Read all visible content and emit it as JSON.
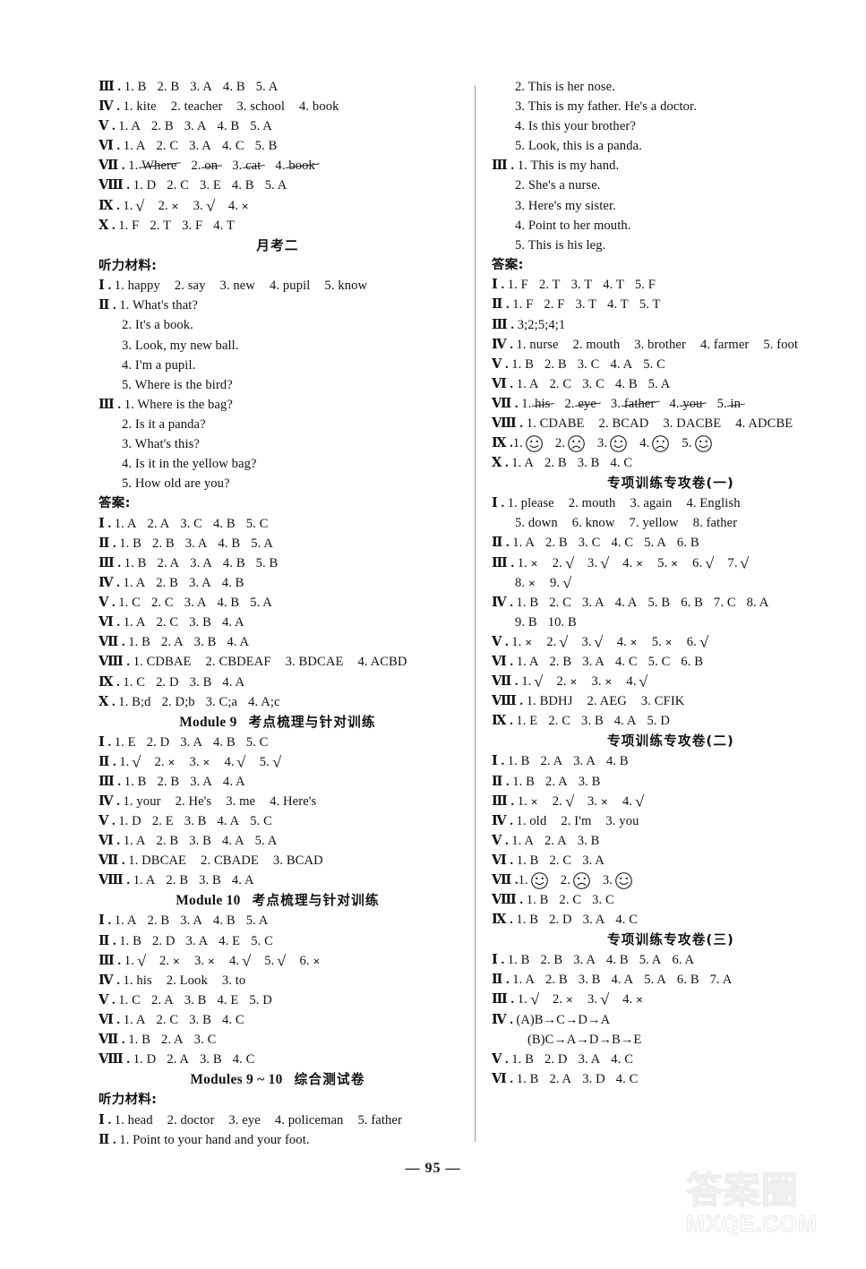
{
  "page": {
    "number": "— 95 —",
    "watermark_cn": "答案圈",
    "watermark_en": "MXQE.COM"
  },
  "labels": {
    "answers": "答案:",
    "listening": "听力材料:"
  },
  "left_column": {
    "top_block": [
      {
        "rn": "Ⅲ",
        "items": [
          "1. B",
          "2. B",
          "3. A",
          "4. B",
          "5. A"
        ]
      },
      {
        "rn": "Ⅳ",
        "items": [
          "1. kite",
          "2. teacher",
          "3. school",
          "4. book"
        ],
        "wide": true
      },
      {
        "rn": "Ⅴ",
        "items": [
          "1. A",
          "2. B",
          "3. A",
          "4. B",
          "5. A"
        ]
      },
      {
        "rn": "Ⅵ",
        "items": [
          "1. A",
          "2. C",
          "3. A",
          "4. C",
          "5. B"
        ]
      },
      {
        "rn": "Ⅶ",
        "fill_items": [
          "1.  Where",
          "2. on",
          "3. cat",
          "4. book"
        ]
      },
      {
        "rn": "Ⅷ",
        "items": [
          "1. D",
          "2. C",
          "3. E",
          "4. B",
          "5. A"
        ]
      },
      {
        "rn": "Ⅸ",
        "marks": [
          [
            "1.",
            "tick"
          ],
          [
            "2.",
            "cross"
          ],
          [
            "3.",
            "tick"
          ],
          [
            "4.",
            "cross"
          ]
        ]
      },
      {
        "rn": "Ⅹ",
        "items": [
          "1. F",
          "2. T",
          "3. F",
          "4. T"
        ]
      }
    ],
    "heading_yuekao2": "月考二",
    "yuekao2_listening": [
      {
        "rn": "Ⅰ",
        "items": [
          "1. happy",
          "2. say",
          "3. new",
          "4. pupil",
          "5. know"
        ],
        "wide": true
      },
      {
        "rn": "Ⅱ",
        "items": [
          "1. What's that?"
        ]
      },
      {
        "indent": true,
        "items": [
          "2. It's a book."
        ]
      },
      {
        "indent": true,
        "items": [
          "3. Look, my new ball."
        ]
      },
      {
        "indent": true,
        "items": [
          "4. I'm a pupil."
        ]
      },
      {
        "indent": true,
        "items": [
          "5. Where is the bird?"
        ]
      },
      {
        "rn": "Ⅲ",
        "items": [
          "1. Where is the bag?"
        ]
      },
      {
        "indent": true,
        "items": [
          "2. Is it a panda?"
        ]
      },
      {
        "indent": true,
        "items": [
          "3. What's this?"
        ]
      },
      {
        "indent": true,
        "items": [
          "4. Is it in the yellow bag?"
        ]
      },
      {
        "indent": true,
        "items": [
          "5. How old are you?"
        ]
      }
    ],
    "yuekao2_answers": [
      {
        "rn": "Ⅰ",
        "items": [
          "1. A",
          "2. A",
          "3. C",
          "4. B",
          "5. C"
        ]
      },
      {
        "rn": "Ⅱ",
        "items": [
          "1. B",
          "2. B",
          "3. A",
          "4. B",
          "5. A"
        ]
      },
      {
        "rn": "Ⅲ",
        "items": [
          "1. B",
          "2. A",
          "3. A",
          "4. B",
          "5. B"
        ]
      },
      {
        "rn": "Ⅳ",
        "items": [
          "1. A",
          "2. B",
          "3. A",
          "4. B"
        ]
      },
      {
        "rn": "Ⅴ",
        "items": [
          "1. C",
          "2. C",
          "3. A",
          "4. B",
          "5. A"
        ]
      },
      {
        "rn": "Ⅵ",
        "items": [
          "1. A",
          "2. C",
          "3. B",
          "4. A"
        ]
      },
      {
        "rn": "Ⅶ",
        "items": [
          "1. B",
          "2. A",
          "3. B",
          "4. A"
        ]
      },
      {
        "rn": "Ⅷ",
        "items": [
          "1. CDBAE",
          "2. CBDEAF",
          "3. BDCAE",
          "4. ACBD"
        ],
        "wide": true
      },
      {
        "rn": "Ⅸ",
        "items": [
          "1. C",
          "2. D",
          "3. B",
          "4. A"
        ]
      },
      {
        "rn": "Ⅹ",
        "items": [
          "1. B;d",
          "2. D;b",
          "3. C;a",
          "4. A;c"
        ]
      }
    ],
    "heading_module9": {
      "en": "Module 9",
      "cn": "考点梳理与针对训练"
    },
    "module9": [
      {
        "rn": "Ⅰ",
        "items": [
          "1. E",
          "2. D",
          "3. A",
          "4. B",
          "5. C"
        ]
      },
      {
        "rn": "Ⅱ",
        "marks": [
          [
            "1.",
            "tick"
          ],
          [
            "2.",
            "cross"
          ],
          [
            "3.",
            "cross"
          ],
          [
            "4.",
            "tick"
          ],
          [
            "5.",
            "tick"
          ]
        ]
      },
      {
        "rn": "Ⅲ",
        "items": [
          "1. B",
          "2. B",
          "3. A",
          "4. A"
        ]
      },
      {
        "rn": "Ⅳ",
        "items": [
          "1. your",
          "2. He's",
          "3. me",
          "4. Here's"
        ],
        "wide": true
      },
      {
        "rn": "Ⅴ",
        "items": [
          "1. D",
          "2. E",
          "3. B",
          "4. A",
          "5. C"
        ]
      },
      {
        "rn": "Ⅵ",
        "items": [
          "1. A",
          "2. B",
          "3. B",
          "4. A",
          "5. A"
        ]
      },
      {
        "rn": "Ⅶ",
        "items": [
          "1. DBCAE",
          "2. CBADE",
          "3. BCAD"
        ],
        "wide": true
      },
      {
        "rn": "Ⅷ",
        "items": [
          "1. A",
          "2. B",
          "3. B",
          "4. A"
        ]
      }
    ],
    "heading_module10": {
      "en": "Module 10",
      "cn": "考点梳理与针对训练"
    },
    "module10": [
      {
        "rn": "Ⅰ",
        "items": [
          "1. A",
          "2. B",
          "3. A",
          "4. B",
          "5. A"
        ]
      },
      {
        "rn": "Ⅱ",
        "items": [
          "1. B",
          "2. D",
          "3. A",
          "4. E",
          "5. C"
        ]
      },
      {
        "rn": "Ⅲ",
        "marks": [
          [
            "1.",
            "tick"
          ],
          [
            "2.",
            "cross"
          ],
          [
            "3.",
            "cross"
          ],
          [
            "4.",
            "tick"
          ],
          [
            "5.",
            "tick"
          ],
          [
            "6.",
            "cross"
          ]
        ]
      },
      {
        "rn": "Ⅳ",
        "items": [
          "1. his",
          "2. Look",
          "3. to"
        ],
        "wide": true
      },
      {
        "rn": "Ⅴ",
        "items": [
          "1. C",
          "2. A",
          "3. B",
          "4. E",
          "5. D"
        ]
      },
      {
        "rn": "Ⅵ",
        "items": [
          "1. A",
          "2. C",
          "3. B",
          "4. C"
        ]
      },
      {
        "rn": "Ⅶ",
        "items": [
          "1. B",
          "2. A",
          "3. C"
        ]
      },
      {
        "rn": "Ⅷ",
        "items": [
          "1. D",
          "2. A",
          "3. B",
          "4. C"
        ]
      }
    ],
    "heading_modules910": {
      "en": "Modules 9 ~ 10",
      "cn": "综合测试卷"
    },
    "modules910_listening": [
      {
        "rn": "Ⅰ",
        "items": [
          "1. head",
          "2. doctor",
          "3. eye",
          "4. policeman",
          "5. father"
        ],
        "wide": true
      },
      {
        "rn": "Ⅱ",
        "items": [
          "1. Point to your hand and your foot."
        ]
      }
    ]
  },
  "right_column": {
    "listening_cont": [
      {
        "indent": true,
        "items": [
          "2. This is her nose."
        ]
      },
      {
        "indent": true,
        "items": [
          "3. This is my father.  He's a doctor."
        ]
      },
      {
        "indent": true,
        "items": [
          "4. Is this your brother?"
        ]
      },
      {
        "indent": true,
        "items": [
          "5. Look, this is a panda."
        ]
      },
      {
        "rn": "Ⅲ",
        "items": [
          "1. This is my hand."
        ]
      },
      {
        "indent": true,
        "items": [
          "2. She's a nurse."
        ]
      },
      {
        "indent": true,
        "items": [
          "3. Here's my sister."
        ]
      },
      {
        "indent": true,
        "items": [
          "4. Point to her mouth."
        ]
      },
      {
        "indent": true,
        "items": [
          "5. This is his leg."
        ]
      }
    ],
    "modules910_answers": [
      {
        "rn": "Ⅰ",
        "items": [
          "1. F",
          "2. T",
          "3. T",
          "4. T",
          "5. F"
        ]
      },
      {
        "rn": "Ⅱ",
        "items": [
          "1. F",
          "2. F",
          "3. T",
          "4. T",
          "5. T"
        ]
      },
      {
        "rn": "Ⅲ",
        "items": [
          "3;2;5;4;1"
        ]
      },
      {
        "rn": "Ⅳ",
        "items": [
          "1. nurse",
          "2. mouth",
          "3. brother",
          "4. farmer",
          "5. foot"
        ],
        "wide": true
      },
      {
        "rn": "Ⅴ",
        "items": [
          "1. B",
          "2. B",
          "3. C",
          "4. A",
          "5. C"
        ]
      },
      {
        "rn": "Ⅵ",
        "items": [
          "1. A",
          "2. C",
          "3. C",
          "4. B",
          "5. A"
        ]
      },
      {
        "rn": "Ⅶ",
        "fill_items": [
          "1.  his",
          "2. eye",
          "3. father",
          "4. you",
          "5. in"
        ]
      },
      {
        "rn": "Ⅷ",
        "items": [
          "1. CDABE",
          "2. BCAD",
          "3. DACBE",
          "4. ADCBE"
        ],
        "wide": true
      },
      {
        "rn": "Ⅸ",
        "faces": [
          [
            "1.",
            "smile"
          ],
          [
            "2.",
            "frown"
          ],
          [
            "3.",
            "smile"
          ],
          [
            "4.",
            "frown"
          ],
          [
            "5.",
            "smile"
          ]
        ]
      },
      {
        "rn": "Ⅹ",
        "items": [
          "1. A",
          "2. B",
          "3. B",
          "4. C"
        ]
      }
    ],
    "heading_zhuanxiang1": "专项训练专攻卷(一)",
    "zhuanxiang1": [
      {
        "rn": "Ⅰ",
        "items": [
          "1. please",
          "2. mouth",
          "3. again",
          "4. English"
        ],
        "wide": true
      },
      {
        "indent": true,
        "items": [
          "5. down",
          "6. know",
          "7. yellow",
          "8. father"
        ],
        "wide": true
      },
      {
        "rn": "Ⅱ",
        "items": [
          "1. A",
          "2. B",
          "3. C",
          "4. C",
          "5. A",
          "6. B"
        ]
      },
      {
        "rn": "Ⅲ",
        "marks": [
          [
            "1.",
            "cross"
          ],
          [
            "2.",
            "tick"
          ],
          [
            "3.",
            "tick"
          ],
          [
            "4.",
            "cross"
          ],
          [
            "5.",
            "cross"
          ],
          [
            "6.",
            "tick"
          ],
          [
            "7.",
            "tick"
          ]
        ]
      },
      {
        "indent": true,
        "marks": [
          [
            "8.",
            "cross"
          ],
          [
            "9.",
            "tick"
          ]
        ]
      },
      {
        "rn": "Ⅳ",
        "items": [
          "1. B",
          "2. C",
          "3. A",
          "4. A",
          "5. B",
          "6. B",
          "7. C",
          "8. A"
        ]
      },
      {
        "indent": true,
        "items": [
          "9. B",
          "10. B"
        ]
      },
      {
        "rn": "Ⅴ",
        "marks": [
          [
            "1.",
            "cross"
          ],
          [
            "2.",
            "tick"
          ],
          [
            "3.",
            "tick"
          ],
          [
            "4.",
            "cross"
          ],
          [
            "5.",
            "cross"
          ],
          [
            "6.",
            "tick"
          ]
        ]
      },
      {
        "rn": "Ⅵ",
        "items": [
          "1. A",
          "2. B",
          "3. A",
          "4. C",
          "5. C",
          "6. B"
        ]
      },
      {
        "rn": "Ⅶ",
        "marks": [
          [
            "1.",
            "tick"
          ],
          [
            "2.",
            "cross"
          ],
          [
            "3.",
            "cross"
          ],
          [
            "4.",
            "tick"
          ]
        ]
      },
      {
        "rn": "Ⅷ",
        "items": [
          "1. BDHJ",
          "2. AEG",
          "3. CFIK"
        ],
        "wide": true
      },
      {
        "rn": "Ⅸ",
        "items": [
          "1. E",
          "2. C",
          "3. B",
          "4. A",
          "5. D"
        ]
      }
    ],
    "heading_zhuanxiang2": "专项训练专攻卷(二)",
    "zhuanxiang2": [
      {
        "rn": "Ⅰ",
        "items": [
          "1. B",
          "2. A",
          "3. A",
          "4. B"
        ]
      },
      {
        "rn": "Ⅱ",
        "items": [
          "1. B",
          "2. A",
          "3. B"
        ]
      },
      {
        "rn": "Ⅲ",
        "marks": [
          [
            "1.",
            "cross"
          ],
          [
            "2.",
            "tick"
          ],
          [
            "3.",
            "cross"
          ],
          [
            "4.",
            "tick"
          ]
        ]
      },
      {
        "rn": "Ⅳ",
        "items": [
          "1. old",
          "2. I'm",
          "3. you"
        ],
        "wide": true
      },
      {
        "rn": "Ⅴ",
        "items": [
          "1. A",
          "2. A",
          "3. B"
        ]
      },
      {
        "rn": "Ⅵ",
        "items": [
          "1. B",
          "2. C",
          "3. A"
        ]
      },
      {
        "rn": "Ⅶ",
        "faces": [
          [
            "1.",
            "smile"
          ],
          [
            "2.",
            "frown"
          ],
          [
            "3.",
            "smile"
          ]
        ]
      },
      {
        "rn": "Ⅷ",
        "items": [
          "1. B",
          "2. C",
          "3. C"
        ]
      },
      {
        "rn": "Ⅸ",
        "items": [
          "1. B",
          "2. D",
          "3. A",
          "4. C"
        ]
      }
    ],
    "heading_zhuanxiang3": "专项训练专攻卷(三)",
    "zhuanxiang3": [
      {
        "rn": "Ⅰ",
        "items": [
          "1. B",
          "2. B",
          "3. A",
          "4. B",
          "5. A",
          "6. A"
        ]
      },
      {
        "rn": "Ⅱ",
        "items": [
          "1. A",
          "2. B",
          "3. B",
          "4. A",
          "5. A",
          "6. B",
          "7. A"
        ]
      },
      {
        "rn": "Ⅲ",
        "marks": [
          [
            "1.",
            "tick"
          ],
          [
            "2.",
            "cross"
          ],
          [
            "3.",
            "tick"
          ],
          [
            "4.",
            "cross"
          ]
        ]
      },
      {
        "rn": "Ⅳ",
        "items": [
          "(A)B→C→D→A"
        ],
        "arrow": true
      },
      {
        "indent2": true,
        "items": [
          "(B)C→A→D→B→E"
        ],
        "arrow": true
      },
      {
        "rn": "Ⅴ",
        "items": [
          "1. B",
          "2. D",
          "3. A",
          "4. C"
        ]
      },
      {
        "rn": "Ⅵ",
        "items": [
          "1. B",
          "2. A",
          "3. D",
          "4. C"
        ]
      }
    ]
  }
}
